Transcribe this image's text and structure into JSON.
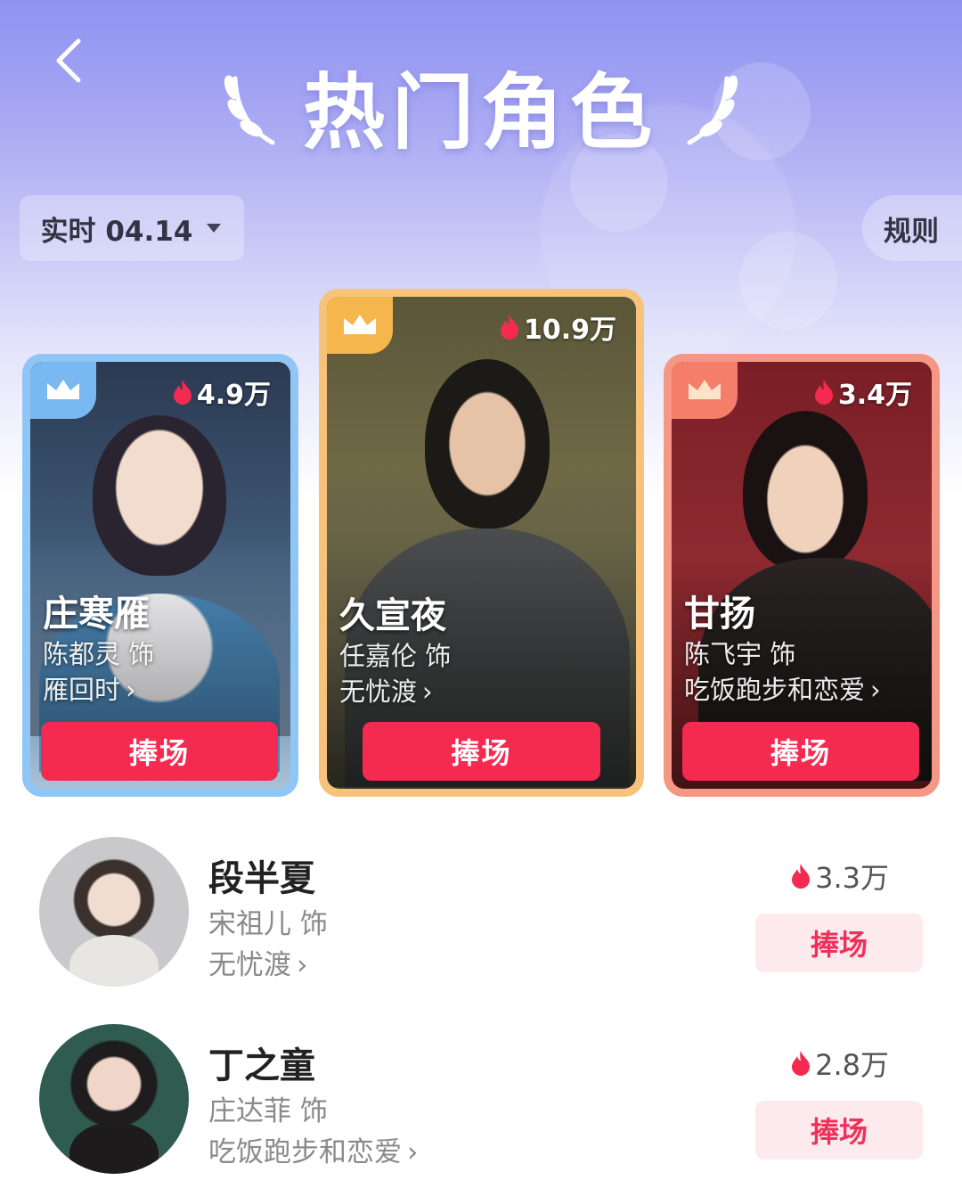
{
  "header": {
    "title": "热门角色",
    "date_label": "实时 04.14",
    "rules_label": "规则"
  },
  "top_cards": [
    {
      "rank_tier": "blue",
      "heat": "4.9万",
      "name": "庄寒雁",
      "actor": "陈都灵 饰",
      "drama": "雁回时",
      "cheer_label": "捧场"
    },
    {
      "rank_tier": "gold",
      "heat": "10.9万",
      "name": "久宣夜",
      "actor": "任嘉伦 饰",
      "drama": "无忧渡",
      "cheer_label": "捧场"
    },
    {
      "rank_tier": "coral",
      "heat": "3.4万",
      "name": "甘扬",
      "actor": "陈飞宇 饰",
      "drama": "吃饭跑步和恋爱",
      "cheer_label": "捧场"
    }
  ],
  "list": [
    {
      "name": "段半夏",
      "actor": "宋祖儿 饰",
      "drama": "无忧渡",
      "heat": "3.3万",
      "cheer_label": "捧场"
    },
    {
      "name": "丁之童",
      "actor": "庄达菲 饰",
      "drama": "吃饭跑步和恋爱",
      "heat": "2.8万",
      "cheer_label": "捧场"
    }
  ],
  "icons": {
    "back": "chevron-left-icon",
    "dropdown": "caret-down-icon",
    "crown": "crown-icon",
    "flame": "flame-icon",
    "laurel": "laurel-icon"
  },
  "colors": {
    "accent": "#f52a51",
    "card_blue": "#8fc6f5",
    "card_gold": "#f7c37a",
    "card_coral": "#f59785",
    "cheer_light_bg": "#fdeaee"
  }
}
